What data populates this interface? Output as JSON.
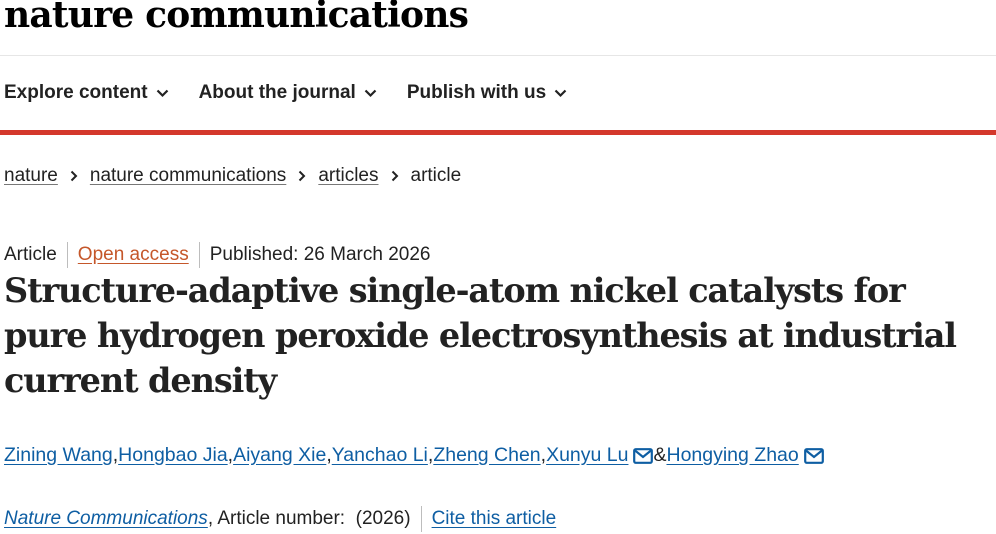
{
  "logo": "nature communications",
  "nav": [
    {
      "label": "Explore content"
    },
    {
      "label": "About the journal"
    },
    {
      "label": "Publish with us"
    }
  ],
  "breadcrumb": {
    "items": [
      "nature",
      "nature communications",
      "articles"
    ],
    "current": "article"
  },
  "meta": {
    "type": "Article",
    "access": "Open access",
    "published": "Published: 26 March 2026"
  },
  "title": "Structure-adaptive single-atom nickel catalysts for pure hydrogen peroxide electrosynthesis at industrial current density",
  "authors": {
    "list": [
      "Zining Wang",
      "Hongbao Jia",
      "Aiyang Xie",
      "Yanchao Li",
      "Zheng Chen",
      "Xunyu Lu",
      "Hongying Zhao"
    ],
    "comma": ", ",
    "ampersand": " & "
  },
  "journal": {
    "name": "Nature Communications",
    "article_number": " , Article number:  (2026)",
    "cite": "Cite this article"
  },
  "colors": {
    "accent_red": "#d4382c",
    "link_blue": "#0e5ea3",
    "open_access": "#c5572a"
  },
  "icons": {
    "nav_chevron": "chevron-down-icon",
    "breadcrumb_sep": "chevron-right-icon",
    "corresponding": "envelope-icon"
  }
}
